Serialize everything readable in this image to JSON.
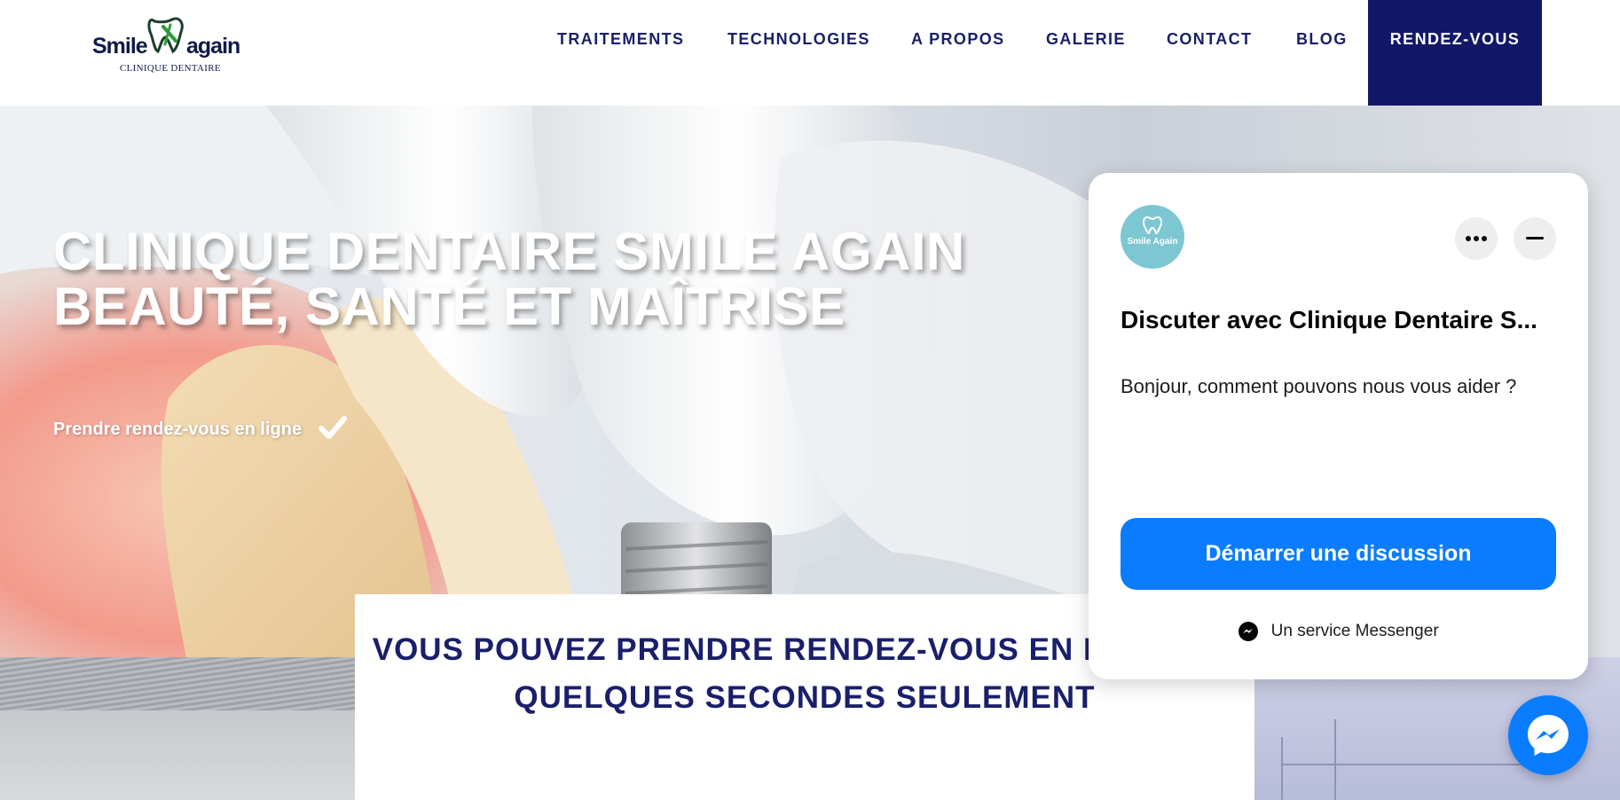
{
  "header": {
    "logo": {
      "word_left": "Smile",
      "word_right": "again",
      "subtitle": "CLINIQUE DENTAIRE"
    },
    "nav": [
      {
        "label": "TRAITEMENTS"
      },
      {
        "label": "TECHNOLOGIES"
      },
      {
        "label": "A PROPOS"
      },
      {
        "label": "GALERIE"
      },
      {
        "label": "CONTACT"
      },
      {
        "label": "BLOG"
      }
    ],
    "cta_label": "RENDEZ-VOUS"
  },
  "hero": {
    "title_line1": "CLINIQUE DENTAIRE SMILE AGAIN",
    "title_line2": "BEAUTÉ, SANTÉ ET MAÎTRISE",
    "cta": "Prendre rendez-vous en ligne"
  },
  "section": {
    "heading_line1": "VOUS POUVEZ PRENDRE RENDEZ-VOUS EN LIGNE EN",
    "heading_line2": "QUELQUES SECONDES SEULEMENT"
  },
  "chat": {
    "avatar_text": "Smile Again",
    "title": "Discuter avec Clinique Dentaire S...",
    "message": "Bonjour, comment pouvons nous vous aider ?",
    "start_button": "Démarrer une discussion",
    "footer": "Un service Messenger"
  },
  "colors": {
    "brand_navy": "#131767",
    "nav_text": "#1a1f6b",
    "messenger_blue": "#0a7cff",
    "avatar_teal": "#7cc7d2"
  }
}
